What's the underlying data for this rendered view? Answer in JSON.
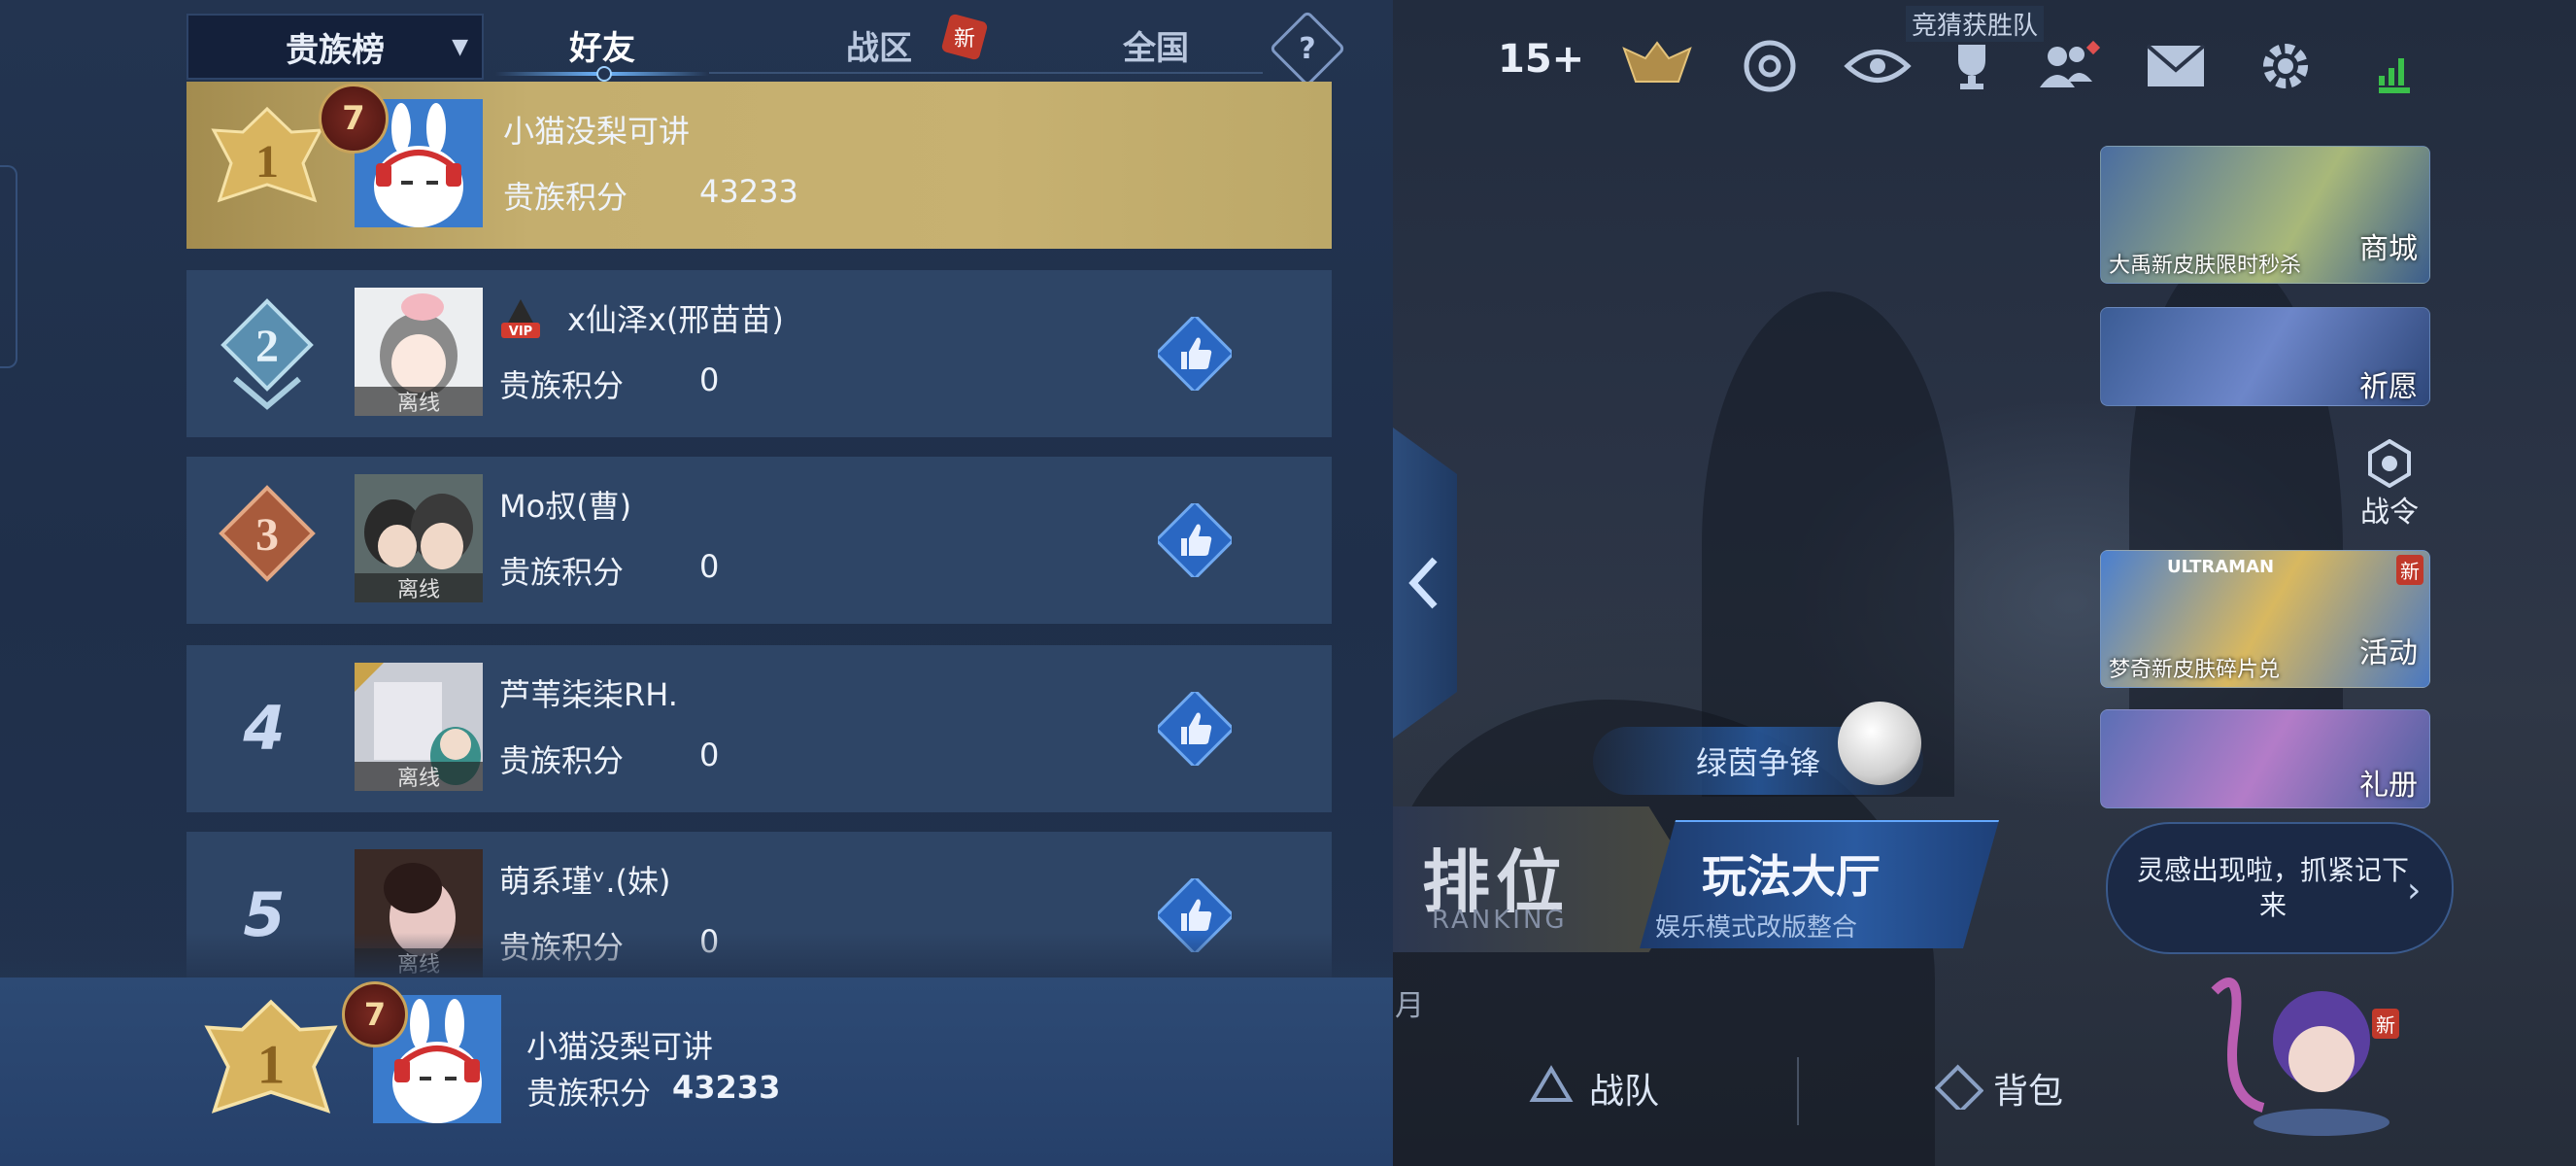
{
  "tabs": {
    "rank_select": "贵族榜",
    "friends": "好友",
    "zone": "战区",
    "zone_badge": "新",
    "national": "全国",
    "help": "?"
  },
  "rows": [
    {
      "rank": "1",
      "level": "7",
      "name": "小猫没梨可讲",
      "score_label": "贵族积分",
      "score": "43233",
      "status": ""
    },
    {
      "rank": "2",
      "name": "x仙泽x(邢苗苗)",
      "score_label": "贵族积分",
      "score": "0",
      "status": "离线",
      "vip": "VIP"
    },
    {
      "rank": "3",
      "name": "Mo叔(曹)",
      "score_label": "贵族积分",
      "score": "0",
      "status": "离线"
    },
    {
      "rank": "4",
      "name": "芦苇柒柒RH.",
      "score_label": "贵族积分",
      "score": "0",
      "status": "离线"
    },
    {
      "rank": "5",
      "name": "萌系瑾ᵛ.(妹)",
      "score_label": "贵族积分",
      "score": "0",
      "status": "离线"
    }
  ],
  "self": {
    "rank": "1",
    "level": "7",
    "name": "小猫没梨可讲",
    "score_label": "贵族积分",
    "score": "43233"
  },
  "topbar": {
    "plus_label": "15+",
    "team_tag": "竞猜获胜队"
  },
  "cards": [
    {
      "label": "商城",
      "sub": "大禹新皮肤限时秒杀"
    },
    {
      "label": "祈愿",
      "sub": ""
    },
    {
      "label": "活动",
      "sub": "梦奇新皮肤碎片兑",
      "badge": "新",
      "brand": "ULTRAMAN"
    },
    {
      "label": "礼册",
      "sub": ""
    }
  ],
  "war_token": "战令",
  "green_event": "绿茵争锋",
  "ranking_button": {
    "title": "排位",
    "sub": "RANKING"
  },
  "hall_button": {
    "title": "玩法大厅",
    "sub": "娱乐模式改版整合"
  },
  "bubble": "灵感出现啦，抓紧记下来",
  "mascot_badge": "新",
  "nav": {
    "team": "战队",
    "bag": "背包",
    "cut": "月"
  },
  "colors": {
    "gold_row": "#c4ae6e",
    "row_bg": "#2e4566",
    "panel_bg": "#233450",
    "badge_red": "#c0392b"
  }
}
